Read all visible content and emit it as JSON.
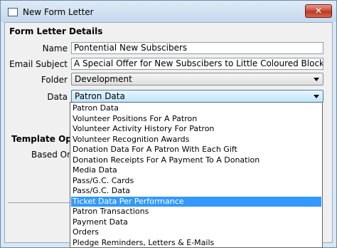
{
  "window": {
    "title": "New Form Letter",
    "close_glyph": "✕"
  },
  "form": {
    "section_title": "Form Letter Details",
    "name_label": "Name",
    "name_value": "Pontential New Subscibers",
    "email_subject_label": "Email Subject",
    "email_subject_value": "A Special Offer for New Subscibers to Little Coloured Blocks",
    "folder_label": "Folder",
    "folder_value": "Development",
    "data_label": "Data",
    "data_value": "Patron Data"
  },
  "template": {
    "section_title_partial": "Template Opt",
    "based_on_label": "Based On"
  },
  "dropdown": {
    "selected_index": 9,
    "options": [
      "Patron Data",
      "Volunteer Positions For A Patron",
      "Volunteer Activity History For Patron",
      "Volunteer Recognition Awards",
      "Donation Data For A Patron With Each Gift",
      "Donation Receipts For A Payment To A Donation",
      "Media Data",
      "Pass/G.C. Cards",
      "Pass/G.C. Data",
      "Ticket Data Per Performance",
      "Patron Transactions",
      "Payment Data",
      "Orders",
      "Pledge Reminders, Letters & E-Mails"
    ]
  },
  "colors": {
    "selection": "#3399ff",
    "close_button": "#c94a36"
  }
}
